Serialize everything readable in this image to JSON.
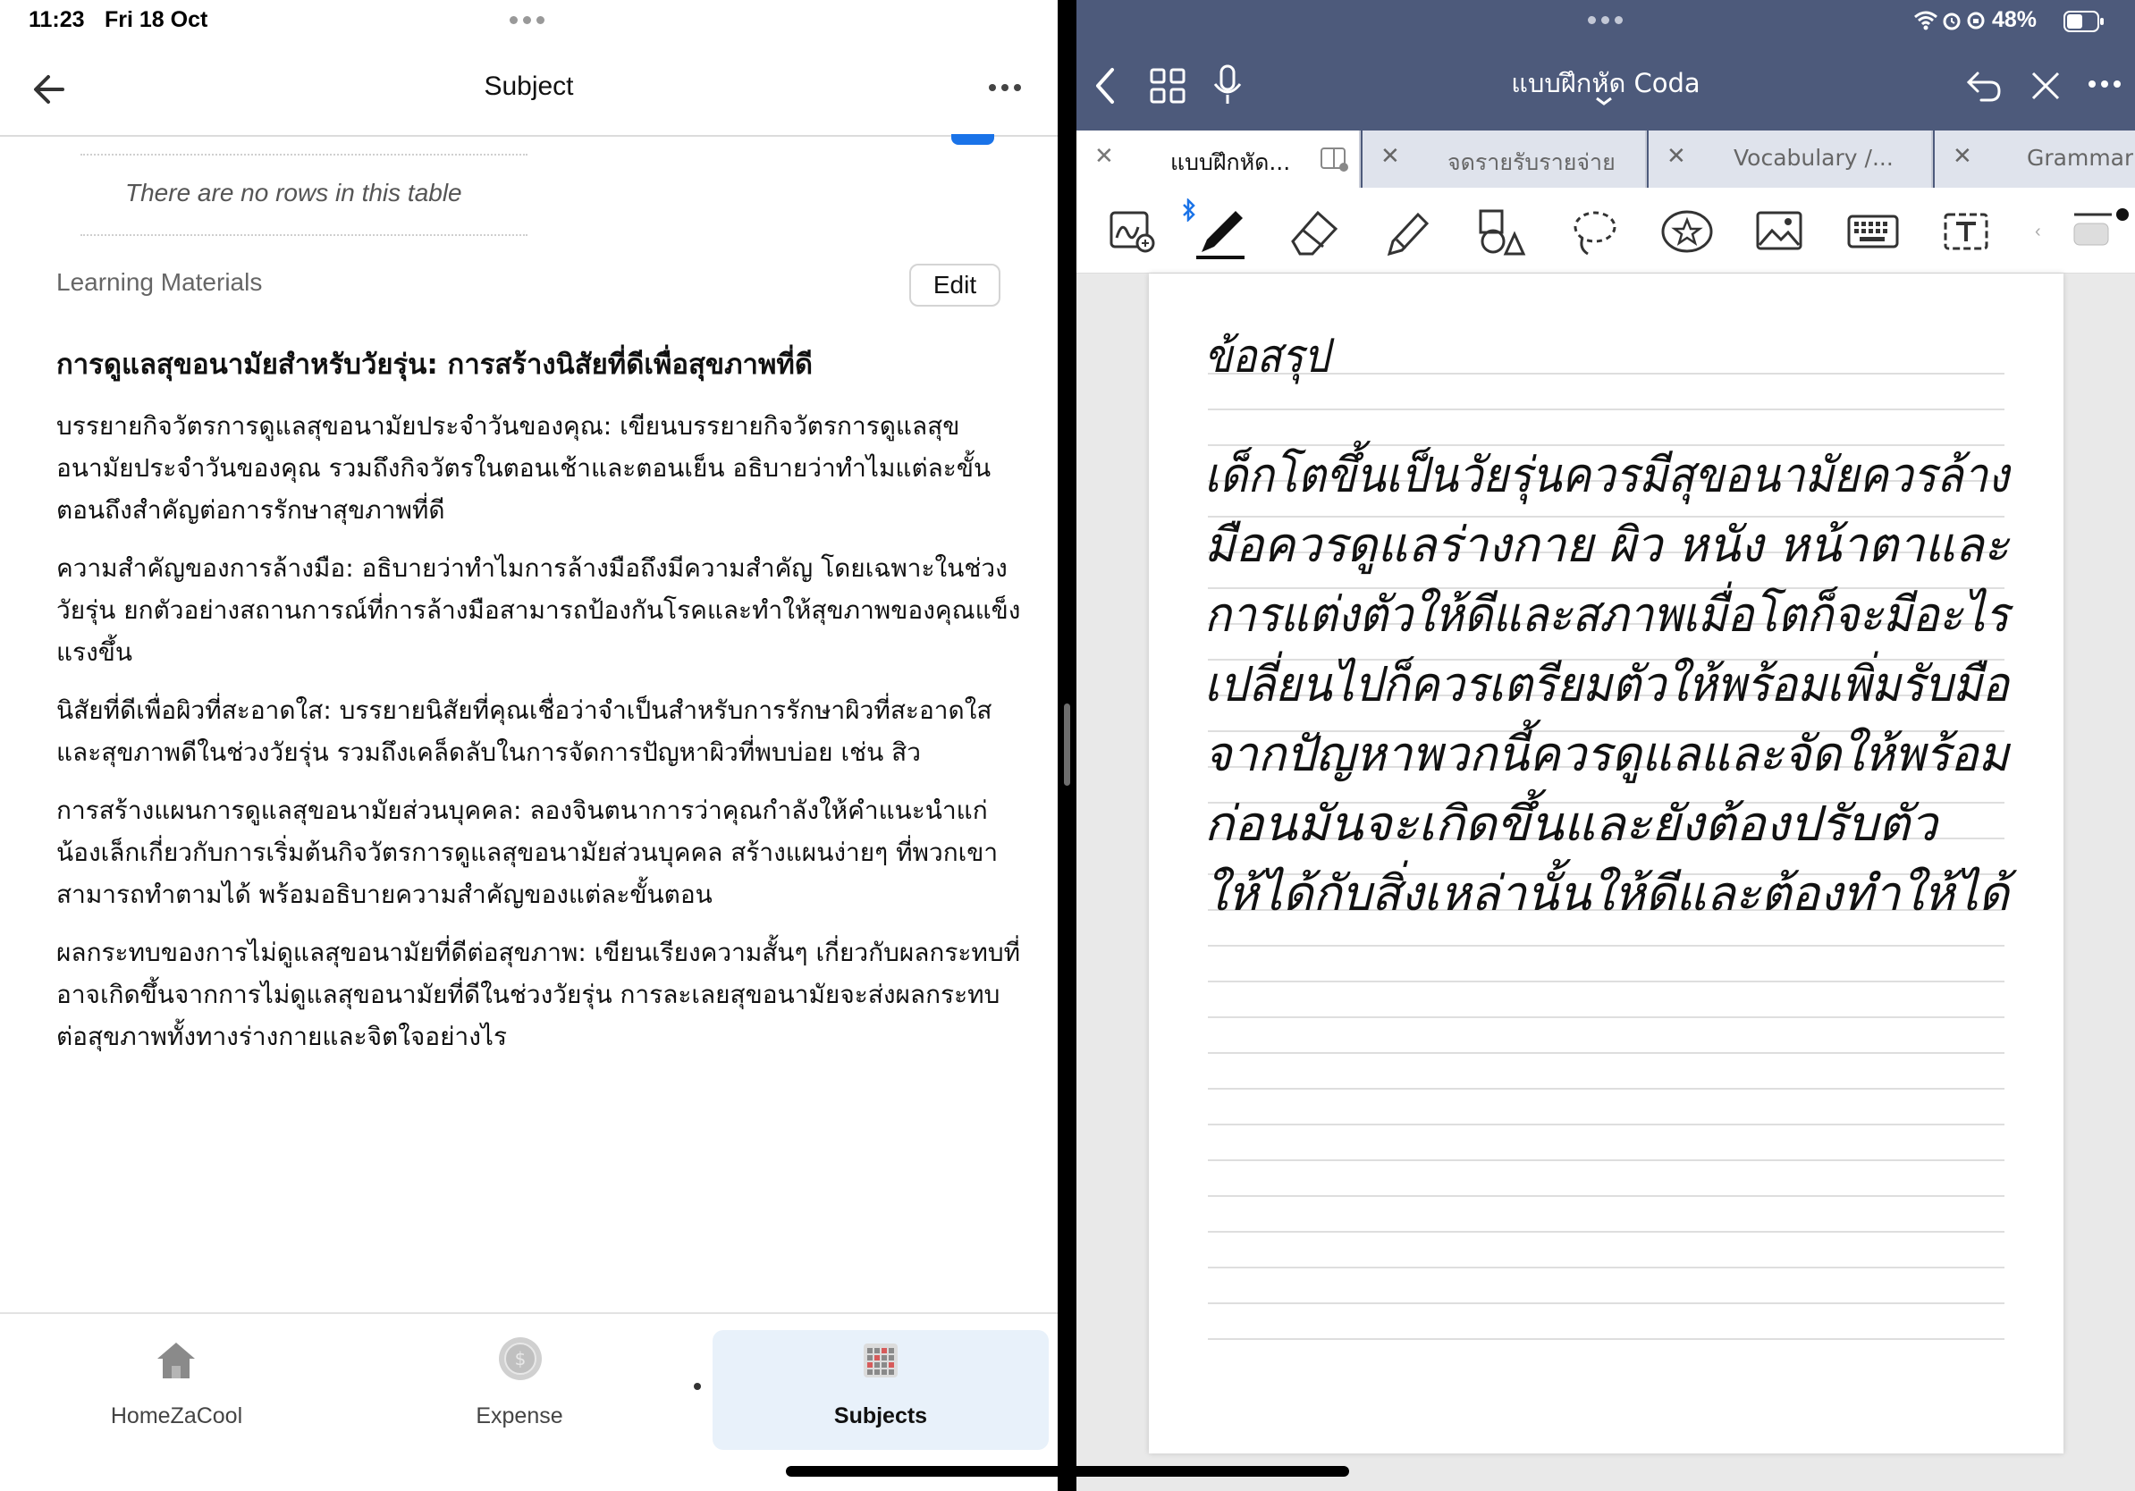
{
  "status": {
    "time": "11:23",
    "date": "Fri 18 Oct",
    "battery": "48%"
  },
  "left": {
    "title": "Subject",
    "empty_table_text": "There are no rows in this table",
    "section_label": "Learning Materials",
    "edit_label": "Edit",
    "doc_title": "การดูแลสุขอนามัยสำหรับวัยรุ่น: การสร้างนิสัยที่ดีเพื่อสุขภาพที่ดี",
    "paragraphs": [
      "บรรยายกิจวัตรการดูแลสุขอนามัยประจำวันของคุณ: เขียนบรรยายกิจวัตรการดูแลสุขอนามัยประจำวันของคุณ รวมถึงกิจวัตรในตอนเช้าและตอนเย็น อธิบายว่าทำไมแต่ละขั้นตอนถึงสำคัญต่อการรักษาสุขภาพที่ดี",
      "ความสำคัญของการล้างมือ: อธิบายว่าทำไมการล้างมือถึงมีความสำคัญ โดยเฉพาะในช่วงวัยรุ่น ยกตัวอย่างสถานการณ์ที่การล้างมือสามารถป้องกันโรคและทำให้สุขภาพของคุณแข็งแรงขึ้น",
      "นิสัยที่ดีเพื่อผิวที่สะอาดใส: บรรยายนิสัยที่คุณเชื่อว่าจำเป็นสำหรับการรักษาผิวที่สะอาดใสและสุขภาพดีในช่วงวัยรุ่น รวมถึงเคล็ดลับในการจัดการปัญหาผิวที่พบบ่อย เช่น สิว",
      "การสร้างแผนการดูแลสุขอนามัยส่วนบุคคล: ลองจินตนาการว่าคุณกำลังให้คำแนะนำแก่น้องเล็กเกี่ยวกับการเริ่มต้นกิจวัตรการดูแลสุขอนามัยส่วนบุคคล สร้างแผนง่ายๆ ที่พวกเขาสามารถทำตามได้ พร้อมอธิบายความสำคัญของแต่ละขั้นตอน",
      "ผลกระทบของการไม่ดูแลสุขอนามัยที่ดีต่อสุขภาพ: เขียนเรียงความสั้นๆ เกี่ยวกับผลกระทบที่อาจเกิดขึ้นจากการไม่ดูแลสุขอนามัยที่ดีในช่วงวัยรุ่น การละเลยสุขอนามัยจะส่งผลกระทบต่อสุขภาพทั้งทางร่างกายและจิตใจอย่างไร"
    ],
    "nav": [
      {
        "label": "HomeZaCool",
        "icon": "house-icon"
      },
      {
        "label": "Expense",
        "icon": "coin-icon"
      },
      {
        "label": "Subjects",
        "icon": "calendar-grid-icon"
      }
    ]
  },
  "right": {
    "notebook_title": "แบบฝึกหัด Coda",
    "tabs": [
      "แบบฝึกหัด...",
      "จดรายรับรายจ่าย",
      "Vocabulary /...",
      "Grammar"
    ],
    "handwriting": [
      "ข้อสรุป",
      "เด็กโตขึ้นเป็นวัยรุ่นควรมีสุขอนามัยควรล้าง",
      "มือควรดูแลร่างกาย ผิว หนัง หน้าตาและ",
      "การแต่งตัวให้ดีและสภาพเมื่อโตก็จะมีอะไร",
      "เปลี่ยนไปก็ควรเตรียมตัวให้พร้อมเพิ่มรับมือ",
      "จากปัญหาพวกนี้ควรดูแลและจัดให้พร้อม",
      "ก่อนมันจะเกิดขึ้นและยังต้องปรับตัว",
      "ให้ได้กับสิ่งเหล่านั้นให้ดีและต้องทำให้ได้"
    ],
    "tools": [
      "lasso-zoom-icon",
      "pen-icon",
      "eraser-icon",
      "highlighter-icon",
      "shapes-icon",
      "lasso-icon",
      "sticker-icon",
      "image-icon",
      "keyboard-icon",
      "text-box-icon"
    ],
    "colors": {
      "header": "#4d5a7b",
      "pen": "#111111",
      "bluetooth": "#1a73e8"
    }
  }
}
